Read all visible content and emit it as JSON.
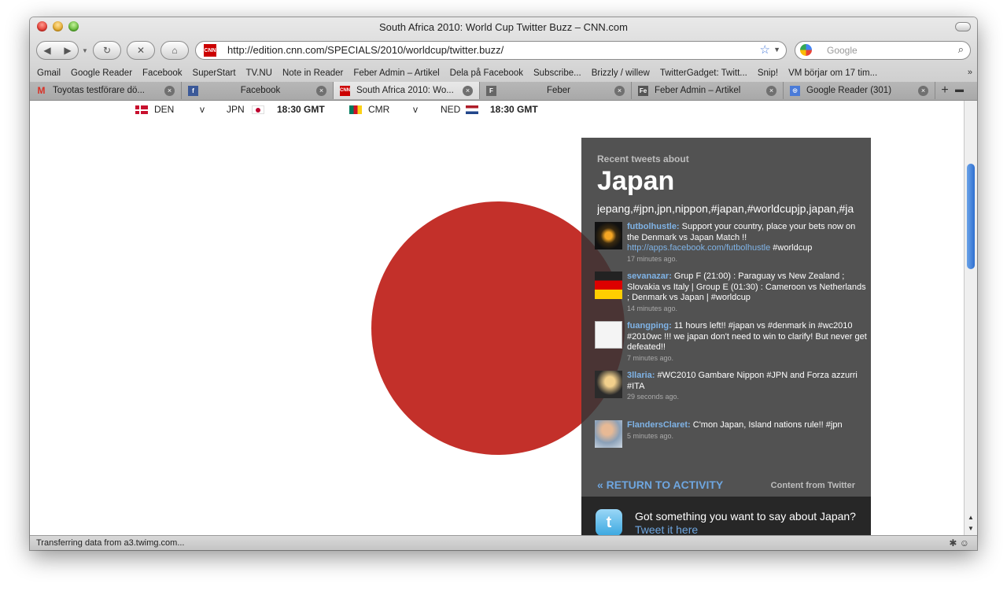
{
  "window": {
    "title": "South Africa 2010: World Cup Twitter Buzz – CNN.com"
  },
  "toolbar": {
    "url": "http://edition.cnn.com/SPECIALS/2010/worldcup/twitter.buzz/",
    "search_placeholder": "Google"
  },
  "bookmarks": [
    "Gmail",
    "Google Reader",
    "Facebook",
    "SuperStart",
    "TV.NU",
    "Note in Reader",
    "Feber Admin – Artikel",
    "Dela på Facebook",
    "Subscribe...",
    "Brizzly / willew",
    "TwitterGadget: Twitt...",
    "Snip!",
    "VM börjar om 17 tim..."
  ],
  "tabs": [
    {
      "label": "Toyotas testförare dö...",
      "favicon": "gmail-icon"
    },
    {
      "label": "Facebook",
      "favicon": "facebook-icon"
    },
    {
      "label": "South Africa 2010: Wo...",
      "favicon": "cnn-icon"
    },
    {
      "label": "Feber",
      "favicon": "feber-icon"
    },
    {
      "label": "Feber Admin – Artikel",
      "favicon": "feber-admin-icon"
    },
    {
      "label": "Google Reader (301)",
      "favicon": "google-reader-icon"
    }
  ],
  "matches": [
    {
      "home": "DEN",
      "v": "v",
      "away": "JPN",
      "time": "18:30 GMT"
    },
    {
      "home": "CMR",
      "v": "v",
      "away": "NED",
      "time": "18:30 GMT"
    }
  ],
  "panel": {
    "recent_label": "Recent tweets about",
    "country": "Japan",
    "tags": "jepang,#jpn,jpn,nippon,#japan,#worldcupjp,japan,#ja",
    "tweets": [
      {
        "user": "futbolhustle:",
        "text": " Support your country, place your bets now on the Denmark vs Japan Match !! ",
        "link": "http://apps.facebook.com/futbolhustle",
        "after": " #worldcup",
        "time": "17 minutes ago."
      },
      {
        "user": "sevanazar:",
        "text": " Grup F (21:00) : Paraguay vs New Zealand ; Slovakia vs Italy | Group E (01:30) : Cameroon vs Netherlands ; Denmark vs Japan | #worldcup",
        "link": "",
        "after": "",
        "time": "14 minutes ago."
      },
      {
        "user": "fuangping:",
        "text": " 11 hours left!! #japan vs #denmark in #wc2010 #2010wc !!! we japan don't need to win to clarify! But never get defeated!!",
        "link": "",
        "after": "",
        "time": "7 minutes ago."
      },
      {
        "user": "3llaria:",
        "text": " #WC2010 Gambare Nippon #JPN  and Forza azzurri #ITA",
        "link": "",
        "after": "",
        "time": "29 seconds ago."
      },
      {
        "user": "FlandersClaret:",
        "text": " C'mon Japan, Island nations rule!! #jpn",
        "link": "",
        "after": "",
        "time": "5 minutes ago."
      }
    ],
    "return_label": "« RETURN TO ACTIVITY",
    "content_from": "Content from Twitter",
    "prompt": "Got something you want to say about Japan?",
    "tweet_here": "Tweet it here"
  },
  "status": {
    "text": "Transferring data from a3.twimg.com..."
  },
  "colors": {
    "sun": "#c3302a",
    "panel": "#363636",
    "link": "#7fb3e6"
  }
}
